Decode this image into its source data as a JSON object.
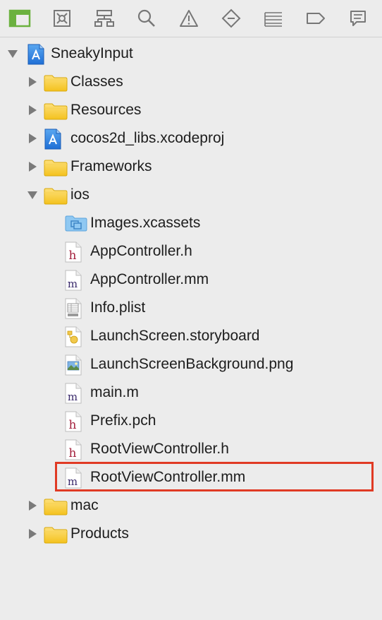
{
  "toolbar": {
    "buttons": [
      {
        "name": "project-navigator-icon",
        "active": true
      },
      {
        "name": "source-control-navigator-icon"
      },
      {
        "name": "symbol-navigator-icon"
      },
      {
        "name": "find-navigator-icon"
      },
      {
        "name": "issue-navigator-icon"
      },
      {
        "name": "test-navigator-icon"
      },
      {
        "name": "debug-navigator-icon"
      },
      {
        "name": "breakpoint-navigator-icon"
      },
      {
        "name": "report-navigator-icon"
      }
    ],
    "accent": "#6bb13f"
  },
  "tree": {
    "items": [
      {
        "label": "SneakyInput",
        "icon": "xcodeproj-icon",
        "expanded": true
      },
      {
        "label": "Classes",
        "icon": "folder-icon",
        "expanded": false
      },
      {
        "label": "Resources",
        "icon": "folder-icon",
        "expanded": false
      },
      {
        "label": "cocos2d_libs.xcodeproj",
        "icon": "xcodeproj-icon",
        "expanded": false
      },
      {
        "label": "Frameworks",
        "icon": "folder-icon",
        "expanded": false
      },
      {
        "label": "ios",
        "icon": "folder-icon",
        "expanded": true
      },
      {
        "label": "Images.xcassets",
        "icon": "xcassets-icon"
      },
      {
        "label": "AppController.h",
        "icon": "header-file-icon"
      },
      {
        "label": "AppController.mm",
        "icon": "objc-file-icon"
      },
      {
        "label": "Info.plist",
        "icon": "plist-file-icon"
      },
      {
        "label": "LaunchScreen.storyboard",
        "icon": "storyboard-file-icon"
      },
      {
        "label": "LaunchScreenBackground.png",
        "icon": "image-file-icon"
      },
      {
        "label": "main.m",
        "icon": "objc-file-icon"
      },
      {
        "label": "Prefix.pch",
        "icon": "header-file-icon"
      },
      {
        "label": "RootViewController.h",
        "icon": "header-file-icon"
      },
      {
        "label": "RootViewController.mm",
        "icon": "objc-file-icon",
        "highlighted": true
      },
      {
        "label": "mac",
        "icon": "folder-icon",
        "expanded": false
      },
      {
        "label": "Products",
        "icon": "folder-icon",
        "expanded": false
      }
    ],
    "highlight_color": "#e03a24"
  }
}
